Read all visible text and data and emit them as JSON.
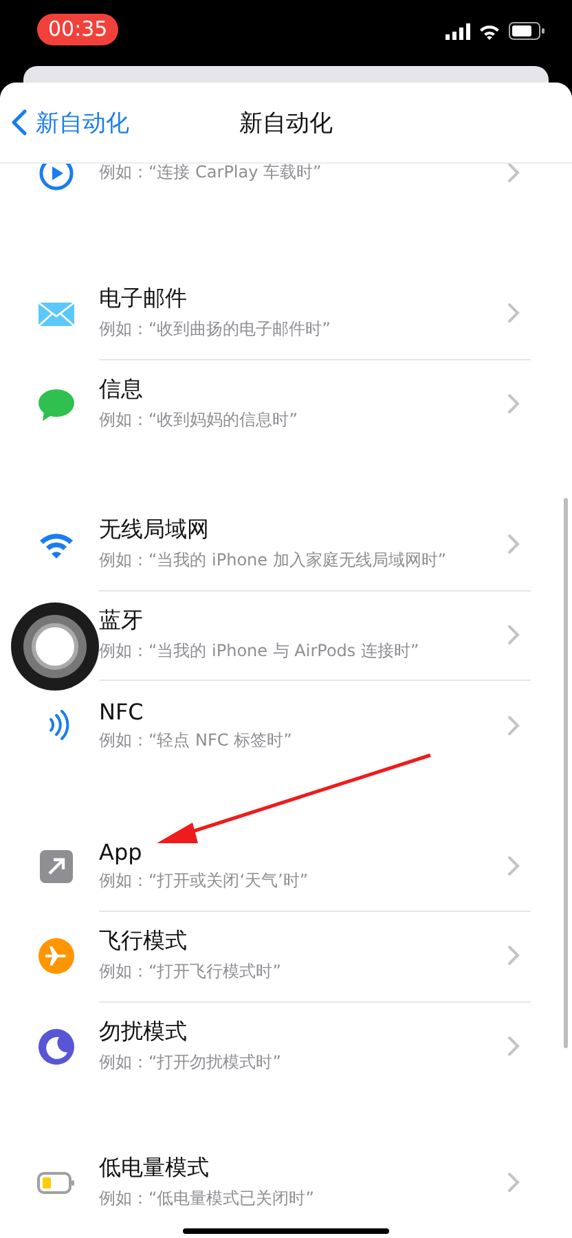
{
  "status_bar": {
    "time": "00:35"
  },
  "nav": {
    "back": "新自动化",
    "title": "新自动化"
  },
  "groups": [
    {
      "items": [
        {
          "kind": "carplay",
          "subtitle": "例如：“连接 CarPlay 车载时”"
        }
      ]
    },
    {
      "items": [
        {
          "kind": "mail",
          "title": "电子邮件",
          "subtitle": "例如：“收到曲扬的电子邮件时”"
        },
        {
          "kind": "messages",
          "title": "信息",
          "subtitle": "例如：“收到妈妈的信息时”"
        }
      ]
    },
    {
      "items": [
        {
          "kind": "wifi",
          "title": "无线局域网",
          "subtitle": "例如：“当我的 iPhone 加入家庭无线局域网时”"
        },
        {
          "kind": "hidden",
          "title": "蓝牙",
          "subtitle": "例如：“当我的 iPhone 与 AirPods 连接时”"
        },
        {
          "kind": "nfc",
          "title": "NFC",
          "subtitle": "例如：“轻点 NFC 标签时”"
        }
      ]
    },
    {
      "items": [
        {
          "kind": "app",
          "title": "App",
          "subtitle": "例如：“打开或关闭‘天气’时”"
        },
        {
          "kind": "airplane",
          "title": "飞行模式",
          "subtitle": "例如：“打开飞行模式时”"
        },
        {
          "kind": "dnd",
          "title": "勿扰模式",
          "subtitle": "例如：“打开勿扰模式时”"
        }
      ]
    },
    {
      "items": [
        {
          "kind": "battery",
          "title": "低电量模式",
          "subtitle": "例如：“低电量模式已关闭时”"
        }
      ]
    }
  ]
}
